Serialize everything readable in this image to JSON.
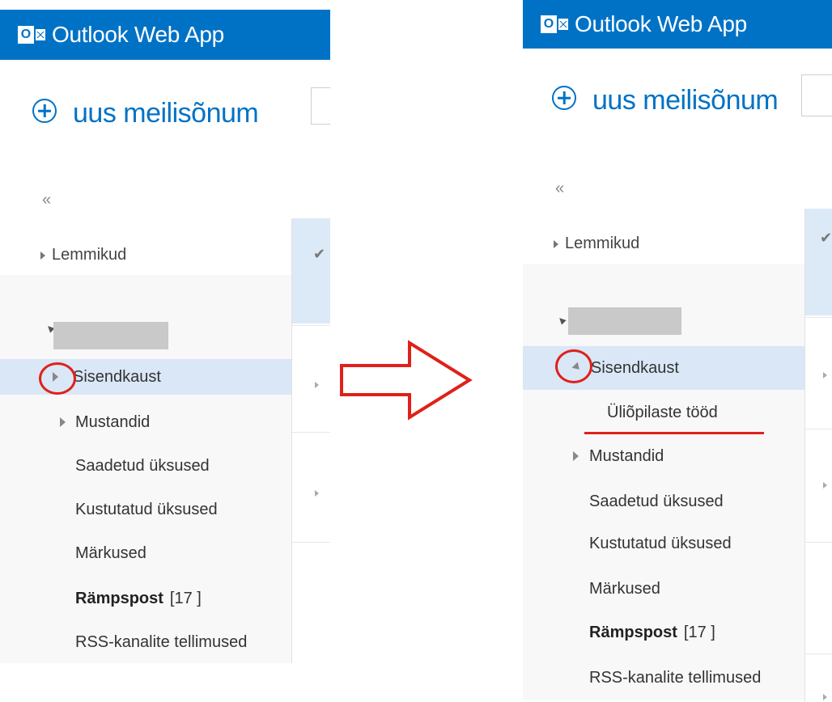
{
  "app": {
    "title": "Outlook Web App",
    "logo_letter": "O"
  },
  "compose": {
    "label": "uus meilisõnum"
  },
  "nav": {
    "collapse_glyph": "«",
    "favorites_label": "Lemmikud",
    "check_glyph": "✔"
  },
  "folders_before": [
    {
      "label": "Sisendkaust",
      "expander": "collapsed",
      "selected": true
    },
    {
      "label": "Mustandid",
      "expander": "collapsed"
    },
    {
      "label": "Saadetud üksused"
    },
    {
      "label": "Kustutatud üksused"
    },
    {
      "label": "Märkused"
    },
    {
      "label": "Rämpspost",
      "count": "[17 ]",
      "bold": true
    },
    {
      "label": "RSS-kanalite tellimused"
    }
  ],
  "folders_after": [
    {
      "label": "Sisendkaust",
      "expander": "expanded",
      "selected": true
    },
    {
      "label": "Üliõpilaste tööd",
      "subfolder": true
    },
    {
      "label": "Mustandid",
      "expander": "collapsed"
    },
    {
      "label": "Saadetud üksused"
    },
    {
      "label": "Kustutatud üksused"
    },
    {
      "label": "Märkused"
    },
    {
      "label": "Rämpspost",
      "count": "[17 ]",
      "bold": true
    },
    {
      "label": "RSS-kanalite tellimused"
    }
  ],
  "colors": {
    "brand": "#0072c6",
    "selection": "#d9e7f6",
    "annotation": "#e0201a"
  }
}
